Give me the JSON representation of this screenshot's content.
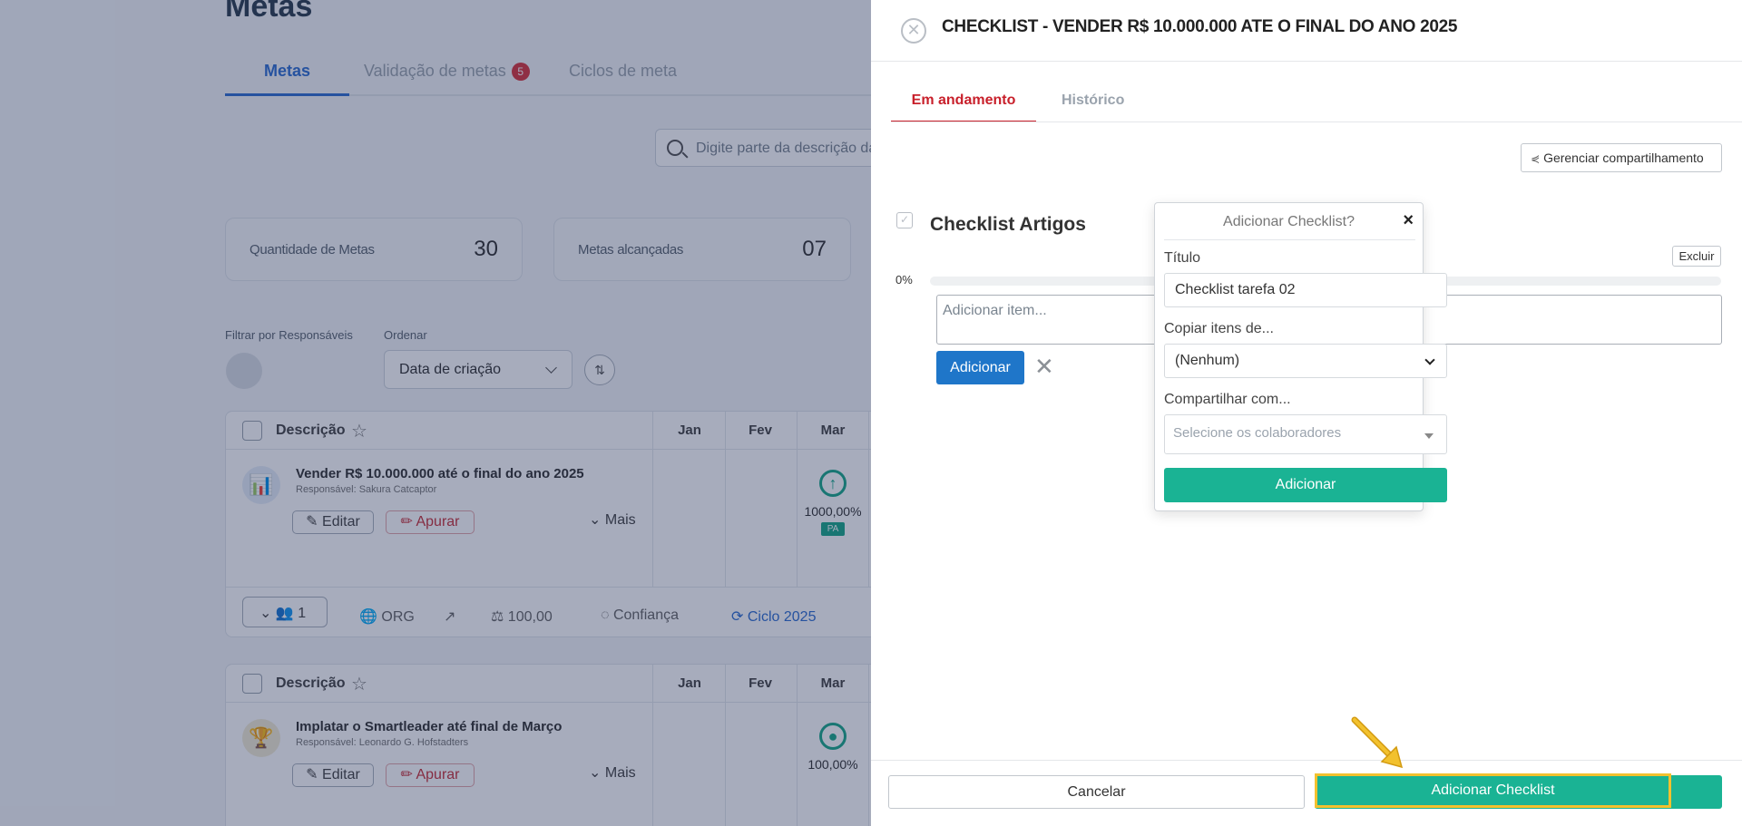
{
  "background": {
    "page_title": "Metas",
    "tabs": [
      {
        "label": "Metas"
      },
      {
        "label": "Validação de metas",
        "badge": "5"
      },
      {
        "label": "Ciclos de meta"
      }
    ],
    "search_placeholder": "Digite parte da descrição da",
    "stats": [
      {
        "label": "Quantidade de Metas",
        "value": "30"
      },
      {
        "label": "Metas alcançadas",
        "value": "07"
      }
    ],
    "filter_label": "Filtrar por Responsáveis",
    "order_label": "Ordenar",
    "order_value": "Data de criação",
    "table_header": {
      "desc": "Descrição",
      "jan": "Jan",
      "fev": "Fev",
      "mar": "Mar"
    },
    "goals": [
      {
        "name": "Vender R$ 10.000.000 até o final do ano 2025",
        "responsible": "Responsável: Sakura Catcaptor",
        "edit": "Editar",
        "apurar": "Apurar",
        "mais": "Mais",
        "status_pct": "1000,00%",
        "badge": "PA"
      },
      {
        "name": "Implatar o Smartleader até final de Março",
        "responsible": "Responsável: Leonardo G. Hofstadters",
        "edit": "Editar",
        "apurar": "Apurar",
        "mais": "Mais",
        "status_pct": "100,00%"
      }
    ],
    "footer": {
      "users": "1",
      "org": "ORG",
      "value": "100,00",
      "confidence": "Confiança",
      "cycle": "Ciclo 2025"
    }
  },
  "panel": {
    "title": "CHECKLIST - VENDER R$ 10.000.000 ATE O FINAL DO ANO 2025",
    "tabs": [
      {
        "label": "Em andamento"
      },
      {
        "label": "Histórico"
      }
    ],
    "share_button": "Gerenciar compartilhamento",
    "checklist_title": "Checklist Artigos",
    "delete_button": "Excluir",
    "progress_text": "0%",
    "progress_value": 0,
    "item_placeholder": "Adicionar item...",
    "add_button": "Adicionar",
    "popover": {
      "title": "Adicionar Checklist?",
      "titulo_label": "Título",
      "titulo_value": "Checklist tarefa 02",
      "copy_label": "Copiar itens de...",
      "copy_value": "(Nenhum)",
      "share_label": "Compartilhar com...",
      "share_placeholder": "Selecione os colaboradores",
      "submit": "Adicionar"
    },
    "cancel_button": "Cancelar",
    "main_button": "Adicionar Checklist"
  },
  "colors": {
    "accent_red": "#c8202b",
    "accent_green": "#1ab394",
    "accent_blue": "#1f76c9",
    "highlight": "#f2c12e"
  }
}
